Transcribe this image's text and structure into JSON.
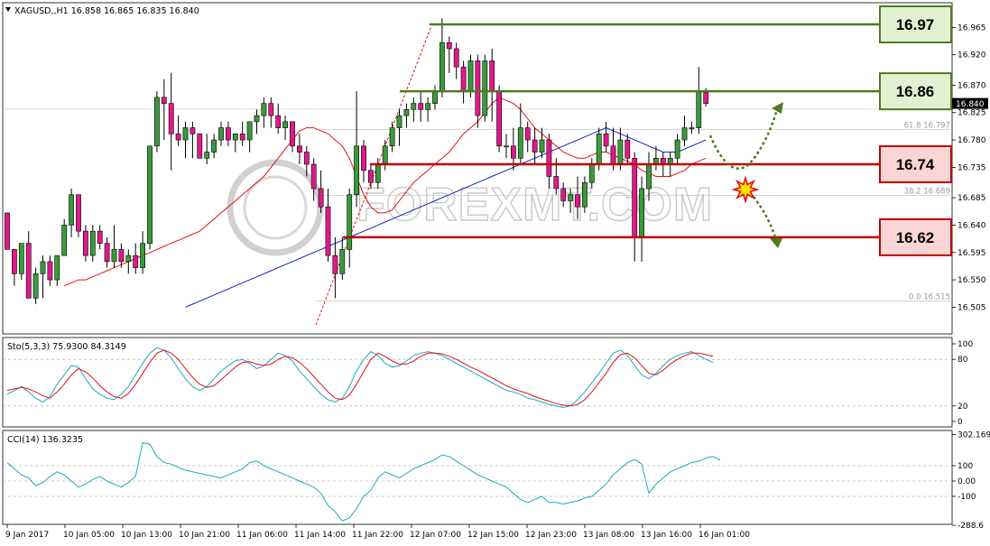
{
  "chart_data": [
    {
      "type": "candlestick",
      "symbol_header": "XAGUSD,,H1  16.858 16.865 16.835 16.840",
      "watermark": "FOREXMT.COM",
      "current_price_label": "16.840",
      "ylim": [
        16.5,
        17.0
      ],
      "y_ticks": [
        "16.965",
        "16.920",
        "16.870",
        "16.825",
        "16.780",
        "16.735",
        "16.685",
        "16.640",
        "16.595",
        "16.550",
        "16.505"
      ],
      "x_ticks": [
        "9 Jan 2017",
        "10 Jan 05:00",
        "10 Jan 13:00",
        "10 Jan 21:00",
        "11 Jan 06:00",
        "11 Jan 14:00",
        "11 Jan 22:00",
        "12 Jan 07:00",
        "12 Jan 15:00",
        "12 Jan 23:00",
        "13 Jan 08:00",
        "13 Jan 16:00",
        "16 Jan 01:00"
      ],
      "fibonacci_labels": [
        {
          "label": "61.8  16.797",
          "value": 16.797
        },
        {
          "label": "38.2  16.689",
          "value": 16.689
        },
        {
          "label": "0.0  16.515",
          "value": 16.515
        }
      ],
      "levels": [
        {
          "label": "16.97",
          "value": 16.97,
          "kind": "resistance",
          "color": "#4f7a22",
          "fill": "#e2f0d0"
        },
        {
          "label": "16.86",
          "value": 16.86,
          "kind": "resistance",
          "color": "#4f7a22",
          "fill": "#e2f0d0"
        },
        {
          "label": "16.74",
          "value": 16.74,
          "kind": "support",
          "color": "#c00000",
          "fill": "#fbd5d5"
        },
        {
          "label": "16.62",
          "value": 16.62,
          "kind": "support",
          "color": "#c00000",
          "fill": "#fbd5d5"
        }
      ],
      "candles": [
        [
          16.66,
          16.65,
          16.6,
          16.6
        ],
        [
          16.6,
          16.6,
          16.54,
          16.56
        ],
        [
          16.56,
          16.61,
          16.55,
          16.61
        ],
        [
          16.61,
          16.63,
          16.52,
          16.52
        ],
        [
          16.52,
          16.57,
          16.51,
          16.56
        ],
        [
          16.56,
          16.59,
          16.52,
          16.58
        ],
        [
          16.58,
          16.59,
          16.54,
          16.55
        ],
        [
          16.55,
          16.59,
          16.54,
          16.59
        ],
        [
          16.59,
          16.65,
          16.59,
          16.64
        ],
        [
          16.64,
          16.7,
          16.62,
          16.69
        ],
        [
          16.69,
          16.69,
          16.62,
          16.63
        ],
        [
          16.63,
          16.64,
          16.58,
          16.59
        ],
        [
          16.59,
          16.64,
          16.58,
          16.63
        ],
        [
          16.63,
          16.64,
          16.6,
          16.61
        ],
        [
          16.61,
          16.62,
          16.57,
          16.58
        ],
        [
          16.58,
          16.64,
          16.57,
          16.6
        ],
        [
          16.6,
          16.61,
          16.57,
          16.58
        ],
        [
          16.58,
          16.6,
          16.56,
          16.59
        ],
        [
          16.59,
          16.61,
          16.56,
          16.57
        ],
        [
          16.57,
          16.63,
          16.56,
          16.61
        ],
        [
          16.61,
          16.77,
          16.6,
          16.77
        ],
        [
          16.77,
          16.86,
          16.76,
          16.85
        ],
        [
          16.85,
          16.88,
          16.78,
          16.84
        ],
        [
          16.84,
          16.89,
          16.73,
          16.79
        ],
        [
          16.79,
          16.82,
          16.77,
          16.78
        ],
        [
          16.78,
          16.81,
          16.75,
          16.8
        ],
        [
          16.8,
          16.81,
          16.75,
          16.79
        ],
        [
          16.79,
          16.79,
          16.75,
          16.75
        ],
        [
          16.75,
          16.79,
          16.74,
          16.76
        ],
        [
          16.76,
          16.79,
          16.75,
          16.78
        ],
        [
          16.78,
          16.81,
          16.77,
          16.8
        ],
        [
          16.8,
          16.81,
          16.77,
          16.78
        ],
        [
          16.78,
          16.79,
          16.76,
          16.79
        ],
        [
          16.79,
          16.81,
          16.77,
          16.78
        ],
        [
          16.78,
          16.81,
          16.76,
          16.81
        ],
        [
          16.81,
          16.83,
          16.79,
          16.82
        ],
        [
          16.82,
          16.85,
          16.8,
          16.84
        ],
        [
          16.84,
          16.85,
          16.8,
          16.82
        ],
        [
          16.82,
          16.84,
          16.79,
          16.8
        ],
        [
          16.8,
          16.82,
          16.78,
          16.81
        ],
        [
          16.81,
          16.81,
          16.76,
          16.77
        ],
        [
          16.77,
          16.79,
          16.74,
          16.76
        ],
        [
          16.76,
          16.77,
          16.72,
          16.74
        ],
        [
          16.74,
          16.75,
          16.68,
          16.7
        ],
        [
          16.7,
          16.73,
          16.66,
          16.67
        ],
        [
          16.67,
          16.7,
          16.58,
          16.59
        ],
        [
          16.59,
          16.62,
          16.52,
          16.56
        ],
        [
          16.56,
          16.62,
          16.55,
          16.6
        ],
        [
          16.6,
          16.7,
          16.57,
          16.69
        ],
        [
          16.69,
          16.86,
          16.67,
          16.77
        ],
        [
          16.77,
          16.78,
          16.71,
          16.73
        ],
        [
          16.73,
          16.74,
          16.7,
          16.71
        ],
        [
          16.71,
          16.75,
          16.7,
          16.74
        ],
        [
          16.74,
          16.78,
          16.73,
          16.77
        ],
        [
          16.77,
          16.81,
          16.76,
          16.8
        ],
        [
          16.8,
          16.83,
          16.77,
          16.82
        ],
        [
          16.82,
          16.84,
          16.8,
          16.83
        ],
        [
          16.83,
          16.85,
          16.81,
          16.84
        ],
        [
          16.84,
          16.86,
          16.81,
          16.83
        ],
        [
          16.83,
          16.85,
          16.81,
          16.84
        ],
        [
          16.84,
          16.87,
          16.83,
          16.86
        ],
        [
          16.86,
          16.98,
          16.85,
          16.94
        ],
        [
          16.94,
          16.95,
          16.89,
          16.93
        ],
        [
          16.93,
          16.94,
          16.88,
          16.9
        ],
        [
          16.9,
          16.91,
          16.84,
          16.86
        ],
        [
          16.86,
          16.92,
          16.85,
          16.91
        ],
        [
          16.91,
          16.92,
          16.8,
          16.82
        ],
        [
          16.82,
          16.92,
          16.81,
          16.91
        ],
        [
          16.91,
          16.93,
          16.81,
          16.86
        ],
        [
          16.86,
          16.87,
          16.76,
          16.77
        ],
        [
          16.77,
          16.79,
          16.75,
          16.77
        ],
        [
          16.77,
          16.8,
          16.73,
          16.75
        ],
        [
          16.75,
          16.84,
          16.74,
          16.8
        ],
        [
          16.8,
          16.81,
          16.76,
          16.78
        ],
        [
          16.78,
          16.8,
          16.74,
          16.76
        ],
        [
          16.76,
          16.8,
          16.75,
          16.78
        ],
        [
          16.78,
          16.79,
          16.7,
          16.72
        ],
        [
          16.72,
          16.75,
          16.69,
          16.7
        ],
        [
          16.7,
          16.71,
          16.67,
          16.68
        ],
        [
          16.68,
          16.7,
          16.66,
          16.69
        ],
        [
          16.69,
          16.72,
          16.65,
          16.67
        ],
        [
          16.67,
          16.72,
          16.66,
          16.71
        ],
        [
          16.71,
          16.75,
          16.7,
          16.74
        ],
        [
          16.74,
          16.8,
          16.73,
          16.79
        ],
        [
          16.79,
          16.81,
          16.76,
          16.77
        ],
        [
          16.77,
          16.8,
          16.73,
          16.74
        ],
        [
          16.74,
          16.8,
          16.73,
          16.78
        ],
        [
          16.78,
          16.79,
          16.74,
          16.75
        ],
        [
          16.75,
          16.76,
          16.58,
          16.62
        ],
        [
          16.62,
          16.72,
          16.58,
          16.7
        ],
        [
          16.7,
          16.76,
          16.68,
          16.74
        ],
        [
          16.74,
          16.77,
          16.73,
          16.75
        ],
        [
          16.75,
          16.76,
          16.72,
          16.74
        ],
        [
          16.74,
          16.76,
          16.72,
          16.75
        ],
        [
          16.75,
          16.79,
          16.74,
          16.78
        ],
        [
          16.78,
          16.82,
          16.77,
          16.8
        ],
        [
          16.8,
          16.81,
          16.79,
          16.8
        ],
        [
          16.8,
          16.9,
          16.79,
          16.86
        ],
        [
          16.858,
          16.865,
          16.835,
          16.84
        ]
      ],
      "sma_red": [
        16.54,
        16.545,
        16.55,
        16.55,
        16.555,
        16.56,
        16.565,
        16.57,
        16.575,
        16.58,
        16.585,
        16.59,
        16.595,
        16.6,
        16.605,
        16.61,
        16.615,
        16.62,
        16.625,
        16.63,
        16.64,
        16.65,
        16.66,
        16.67,
        16.68,
        16.69,
        16.7,
        16.71,
        16.72,
        16.735,
        16.75,
        16.765,
        16.78,
        16.795,
        16.8,
        16.8,
        16.795,
        16.79,
        16.78,
        16.77,
        16.75,
        16.72,
        16.69,
        16.67,
        16.66,
        16.66,
        16.665,
        16.68,
        16.695,
        16.71,
        16.72,
        16.73,
        16.74,
        16.75,
        16.76,
        16.775,
        16.79,
        16.8,
        16.81,
        16.825,
        16.84,
        16.85,
        16.845,
        16.84,
        16.83,
        16.815,
        16.8,
        16.79,
        16.78,
        16.77,
        16.76,
        16.755,
        16.75,
        16.75,
        16.755,
        16.76,
        16.76,
        16.755,
        16.75,
        16.745,
        16.74,
        16.73,
        16.725,
        16.72,
        16.72,
        16.72,
        16.725,
        16.73,
        16.74,
        16.745,
        16.75
      ],
      "sma_blue": [
        16.505,
        16.51,
        16.515,
        16.52,
        16.525,
        16.53,
        16.535,
        16.54,
        16.545,
        16.55,
        16.555,
        16.56,
        16.565,
        16.57,
        16.575,
        16.58,
        16.585,
        16.59,
        16.595,
        16.6,
        16.605,
        16.61,
        16.615,
        16.62,
        16.625,
        16.63,
        16.635,
        16.64,
        16.645,
        16.65,
        16.655,
        16.66,
        16.665,
        16.67,
        16.675,
        16.68,
        16.685,
        16.69,
        16.695,
        16.7,
        16.705,
        16.71,
        16.715,
        16.72,
        16.725,
        16.73,
        16.735,
        16.74,
        16.745,
        16.75,
        16.755,
        16.76,
        16.765,
        16.77,
        16.775,
        16.78,
        16.785,
        16.79,
        16.795,
        16.8,
        16.795,
        16.79,
        16.785,
        16.78,
        16.775,
        16.77,
        16.765,
        16.76,
        16.76,
        16.76,
        16.765,
        16.77,
        16.775,
        16.78
      ],
      "forecast_up": "16.86",
      "forecast_down": "16.62"
    },
    {
      "type": "line",
      "header": "Sto(5,3,3) 75.9300 84.3149",
      "ylim": [
        0,
        100
      ],
      "y_ticks": [
        "100",
        "80",
        "20",
        "0"
      ],
      "levels": [
        80,
        20
      ],
      "main": [
        35,
        40,
        45,
        38,
        30,
        25,
        32,
        48,
        60,
        72,
        70,
        55,
        42,
        35,
        30,
        28,
        35,
        45,
        60,
        75,
        88,
        95,
        92,
        82,
        68,
        55,
        45,
        40,
        45,
        55,
        65,
        72,
        78,
        80,
        75,
        68,
        72,
        80,
        88,
        85,
        78,
        65,
        55,
        45,
        35,
        28,
        25,
        30,
        45,
        65,
        80,
        90,
        85,
        75,
        70,
        72,
        78,
        85,
        88,
        90,
        88,
        85,
        80,
        75,
        70,
        65,
        60,
        55,
        50,
        45,
        40,
        38,
        35,
        30,
        28,
        25,
        22,
        20,
        18,
        20,
        28,
        38,
        50,
        62,
        75,
        88,
        92,
        85,
        72,
        60,
        55,
        62,
        72,
        80,
        85,
        88,
        90,
        85,
        80,
        76
      ],
      "signal": [
        40,
        42,
        44,
        42,
        38,
        33,
        30,
        38,
        48,
        60,
        68,
        64,
        56,
        46,
        38,
        32,
        30,
        36,
        48,
        62,
        76,
        88,
        92,
        88,
        80,
        68,
        57,
        48,
        44,
        46,
        54,
        62,
        70,
        76,
        77,
        74,
        72,
        74,
        80,
        84,
        82,
        76,
        68,
        58,
        48,
        38,
        30,
        28,
        34,
        48,
        64,
        80,
        88,
        84,
        78,
        74,
        74,
        78,
        84,
        88,
        88,
        87,
        84,
        80,
        75,
        70,
        66,
        61,
        56,
        51,
        46,
        42,
        39,
        36,
        32,
        29,
        26,
        23,
        21,
        20,
        22,
        28,
        38,
        50,
        62,
        76,
        86,
        88,
        82,
        72,
        62,
        60,
        66,
        74,
        80,
        85,
        88,
        88,
        86,
        84
      ]
    },
    {
      "type": "line",
      "header": "CCI(14) 136.3235",
      "ylim": [
        -288.6,
        302.17
      ],
      "y_ticks": [
        "302.1692",
        "100",
        "0.00",
        "-100",
        "-288.6"
      ],
      "levels": [
        100,
        0,
        -100
      ],
      "values": [
        120,
        80,
        40,
        20,
        -30,
        -10,
        30,
        60,
        40,
        0,
        -40,
        -20,
        10,
        30,
        0,
        -20,
        -40,
        -10,
        30,
        250,
        240,
        160,
        120,
        110,
        90,
        70,
        60,
        50,
        40,
        30,
        20,
        40,
        60,
        80,
        120,
        130,
        100,
        80,
        60,
        40,
        20,
        0,
        -20,
        -40,
        -80,
        -160,
        -200,
        -260,
        -240,
        -180,
        -100,
        -60,
        20,
        60,
        40,
        20,
        50,
        80,
        100,
        120,
        140,
        170,
        160,
        130,
        100,
        70,
        40,
        20,
        0,
        -20,
        -40,
        -80,
        -120,
        -140,
        -120,
        -100,
        -140,
        -140,
        -150,
        -140,
        -130,
        -110,
        -100,
        -60,
        -20,
        40,
        80,
        120,
        140,
        110,
        -80,
        -20,
        20,
        60,
        80,
        100,
        120,
        130,
        150,
        160,
        136
      ]
    }
  ]
}
